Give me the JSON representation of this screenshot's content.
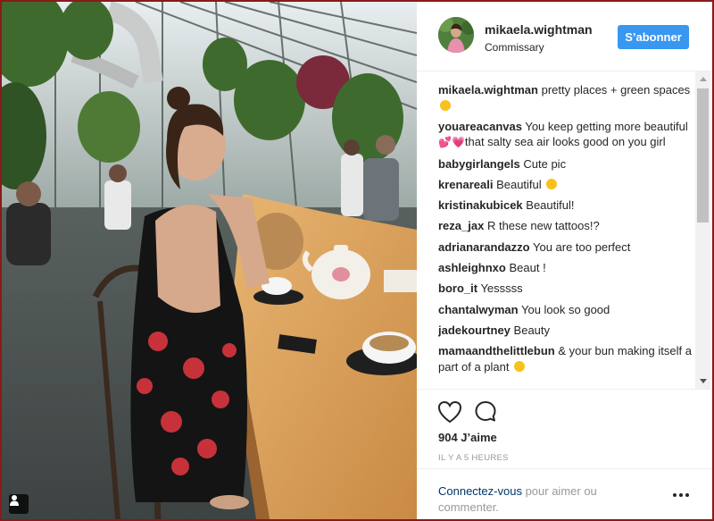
{
  "post": {
    "username": "mikaela.wightman",
    "location": "Commissary",
    "follow_label": "S’abonner",
    "likes": "904 J’aime",
    "time": "IL Y A 5 HEURES",
    "login_link": "Connectez-vous",
    "login_rest": " pour aimer ou commenter."
  },
  "comments": [
    {
      "author": "mikaela.wightman",
      "text": "pretty places + green spaces",
      "emoji": "heart-eyes"
    },
    {
      "author": "youareacanvas",
      "text": "You keep getting more beautiful",
      "emoji2": "hearts",
      "text2": "that salty sea air looks good on you girl"
    },
    {
      "author": "babygirlangels",
      "text": "Cute pic"
    },
    {
      "author": "krenareali",
      "text": "Beautiful",
      "emoji": "kiss"
    },
    {
      "author": "kristinakubicek",
      "text": "Beautiful!"
    },
    {
      "author": "reza_jax",
      "text": "R these new tattoos!?"
    },
    {
      "author": "adrianarandazzo",
      "text": "You are too perfect"
    },
    {
      "author": "ashleighnxo",
      "text": "Beaut !"
    },
    {
      "author": "boro_it",
      "text": "Yesssss"
    },
    {
      "author": "chantalwyman",
      "text": "You look so good"
    },
    {
      "author": "jadekourtney",
      "text": "Beauty"
    },
    {
      "author": "mamaandthelittlebun",
      "text": "& your bun making itself a part of a plant",
      "emoji": "heart-eyes"
    }
  ],
  "colors": {
    "accent": "#3897f0",
    "text": "#262626",
    "muted": "#999999",
    "link": "#003569",
    "window_border": "#8a1a1a"
  },
  "icons": [
    "heart-icon",
    "comment-icon",
    "more-options-icon",
    "user-tag-icon",
    "scroll-up-icon",
    "scroll-down-icon"
  ]
}
